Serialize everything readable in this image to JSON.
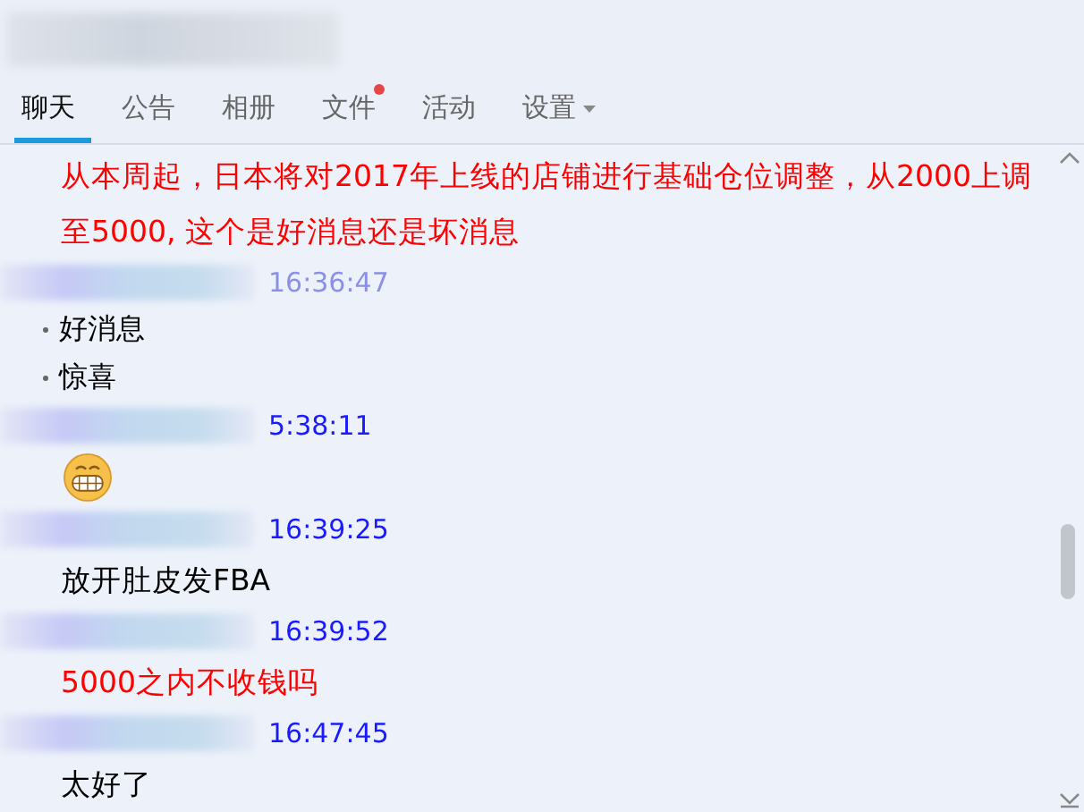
{
  "tabs": [
    {
      "label": "聊天",
      "selected": true,
      "badge": false,
      "dropdown": false
    },
    {
      "label": "公告",
      "selected": false,
      "badge": false,
      "dropdown": false
    },
    {
      "label": "相册",
      "selected": false,
      "badge": false,
      "dropdown": false
    },
    {
      "label": "文件",
      "selected": false,
      "badge": true,
      "dropdown": false
    },
    {
      "label": "活动",
      "selected": false,
      "badge": false,
      "dropdown": false
    },
    {
      "label": "设置",
      "selected": false,
      "badge": false,
      "dropdown": true
    }
  ],
  "messages": [
    {
      "kind": "text",
      "text": "从本周起，日本将对2017年上线的店铺进行基础仓位调整，从2000上调至5000, 这个是好消息还是坏消息",
      "color": "#ff0000"
    },
    {
      "kind": "header",
      "time": "16:36:47",
      "faded": true
    },
    {
      "kind": "bullets",
      "items": [
        "好消息",
        "惊喜"
      ]
    },
    {
      "kind": "header",
      "time": "5:38:11",
      "faded": false
    },
    {
      "kind": "emoji"
    },
    {
      "kind": "header",
      "time": "16:39:25",
      "faded": false
    },
    {
      "kind": "text",
      "text": "放开肚皮发FBA",
      "color": "#000000"
    },
    {
      "kind": "header",
      "time": "16:39:52",
      "faded": false
    },
    {
      "kind": "text",
      "text": "5000之内不收钱吗",
      "color": "#ff0000"
    },
    {
      "kind": "header",
      "time": "16:47:45",
      "faded": false
    },
    {
      "kind": "text",
      "text": "太好了",
      "color": "#000000"
    }
  ]
}
